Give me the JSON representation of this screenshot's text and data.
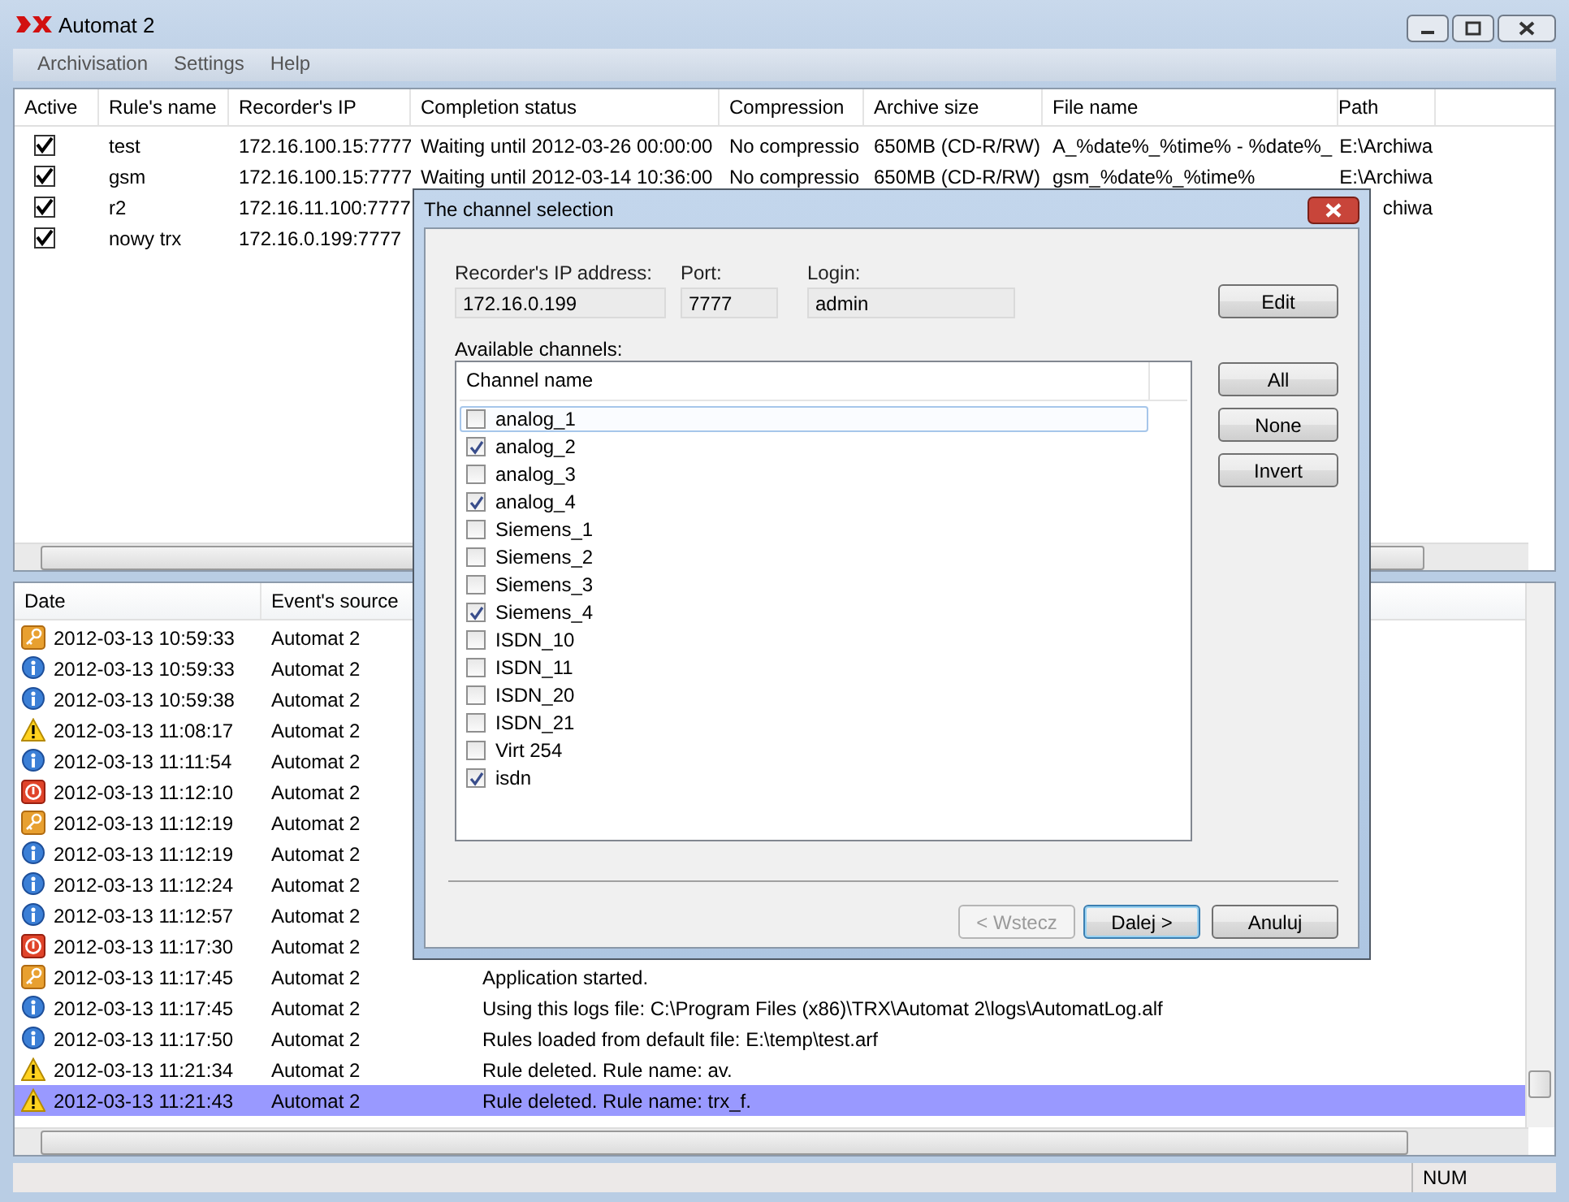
{
  "window": {
    "title": "Automat 2"
  },
  "menu": [
    "Archivisation",
    "Settings",
    "Help"
  ],
  "rules_table": {
    "columns": [
      "Active",
      "Rule's name",
      "Recorder's IP",
      "Completion status",
      "Compression",
      "Archive size",
      "File name",
      "Path"
    ],
    "rows": [
      {
        "active": true,
        "cells": [
          "",
          "test",
          "172.16.100.15:7777",
          "Waiting until 2012-03-26 00:00:00",
          "No compressio",
          "650MB (CD-R/RW)",
          "A_%date%_%time% - %date%_",
          "E:\\Archiwa"
        ]
      },
      {
        "active": true,
        "cells": [
          "",
          "gsm",
          "172.16.100.15:7777",
          "Waiting until 2012-03-14 10:36:00",
          "No compressio",
          "650MB (CD-R/RW)",
          "gsm_%date%_%time%",
          "E:\\Archiwa"
        ]
      },
      {
        "active": true,
        "cells": [
          "",
          "r2",
          "172.16.11.100:7777",
          null,
          null,
          null,
          null,
          "chiwa"
        ]
      },
      {
        "active": true,
        "cells": [
          "",
          "nowy trx",
          "172.16.0.199:7777",
          null,
          null,
          null,
          null,
          null
        ]
      }
    ]
  },
  "log": {
    "columns": [
      "Date",
      "Event's source"
    ],
    "rows": [
      {
        "kind": "key",
        "date": "2012-03-13 10:59:33",
        "source": "Automat 2",
        "selected": false
      },
      {
        "kind": "info",
        "date": "2012-03-13 10:59:33",
        "source": "Automat 2",
        "selected": false
      },
      {
        "kind": "info",
        "date": "2012-03-13 10:59:38",
        "source": "Automat 2",
        "selected": false
      },
      {
        "kind": "warning",
        "date": "2012-03-13 11:08:17",
        "source": "Automat 2",
        "selected": false
      },
      {
        "kind": "info",
        "date": "2012-03-13 11:11:54",
        "source": "Automat 2",
        "selected": false
      },
      {
        "kind": "error",
        "date": "2012-03-13 11:12:10",
        "source": "Automat 2",
        "selected": false
      },
      {
        "kind": "key",
        "date": "2012-03-13 11:12:19",
        "source": "Automat 2",
        "selected": false
      },
      {
        "kind": "info",
        "date": "2012-03-13 11:12:19",
        "source": "Automat 2",
        "selected": false
      },
      {
        "kind": "info",
        "date": "2012-03-13 11:12:24",
        "source": "Automat 2",
        "selected": false
      },
      {
        "kind": "info",
        "date": "2012-03-13 11:12:57",
        "source": "Automat 2",
        "selected": false
      },
      {
        "kind": "error",
        "date": "2012-03-13 11:17:30",
        "source": "Automat 2",
        "selected": false
      },
      {
        "kind": "key",
        "date": "2012-03-13 11:17:45",
        "source": "Automat 2",
        "message": "Application started.",
        "selected": false
      },
      {
        "kind": "info",
        "date": "2012-03-13 11:17:45",
        "source": "Automat 2",
        "message": "Using this logs file: C:\\Program Files (x86)\\TRX\\Automat 2\\logs\\AutomatLog.alf",
        "selected": false
      },
      {
        "kind": "info",
        "date": "2012-03-13 11:17:50",
        "source": "Automat 2",
        "message": "Rules loaded from default file: E:\\temp\\test.arf",
        "selected": false
      },
      {
        "kind": "warning",
        "date": "2012-03-13 11:21:34",
        "source": "Automat 2",
        "message": "Rule deleted. Rule name: av.",
        "selected": false
      },
      {
        "kind": "warning",
        "date": "2012-03-13 11:21:43",
        "source": "Automat 2",
        "message": "Rule deleted. Rule name: trx_f.",
        "selected": true
      }
    ]
  },
  "status_bar": {
    "num": "NUM"
  },
  "dialog": {
    "title": "The channel selection",
    "fields": [
      {
        "label": "Recorder's IP address:",
        "value": "172.16.0.199"
      },
      {
        "label": "Port:",
        "value": "7777"
      },
      {
        "label": "Login:",
        "value": "admin"
      }
    ],
    "edit_button": "Edit",
    "channels_label": "Available channels:",
    "channels_header": "Channel name",
    "channels": [
      {
        "name": "analog_1",
        "checked": false,
        "focused": true
      },
      {
        "name": "analog_2",
        "checked": true,
        "focused": false
      },
      {
        "name": "analog_3",
        "checked": false,
        "focused": false
      },
      {
        "name": "analog_4",
        "checked": true,
        "focused": false
      },
      {
        "name": "Siemens_1",
        "checked": false,
        "focused": false
      },
      {
        "name": "Siemens_2",
        "checked": false,
        "focused": false
      },
      {
        "name": "Siemens_3",
        "checked": false,
        "focused": false
      },
      {
        "name": "Siemens_4",
        "checked": true,
        "focused": false
      },
      {
        "name": "ISDN_10",
        "checked": false,
        "focused": false
      },
      {
        "name": "ISDN_11",
        "checked": false,
        "focused": false
      },
      {
        "name": "ISDN_20",
        "checked": false,
        "focused": false
      },
      {
        "name": "ISDN_21",
        "checked": false,
        "focused": false
      },
      {
        "name": "Virt 254",
        "checked": false,
        "focused": false
      },
      {
        "name": "isdn",
        "checked": true,
        "focused": false
      }
    ],
    "side_buttons": [
      "All",
      "None",
      "Invert"
    ],
    "footer_buttons": [
      {
        "label": "< Wstecz",
        "disabled": true,
        "default": false
      },
      {
        "label": "Dalej >",
        "disabled": false,
        "default": true
      },
      {
        "label": "Anuluj",
        "disabled": false,
        "default": false
      }
    ]
  }
}
